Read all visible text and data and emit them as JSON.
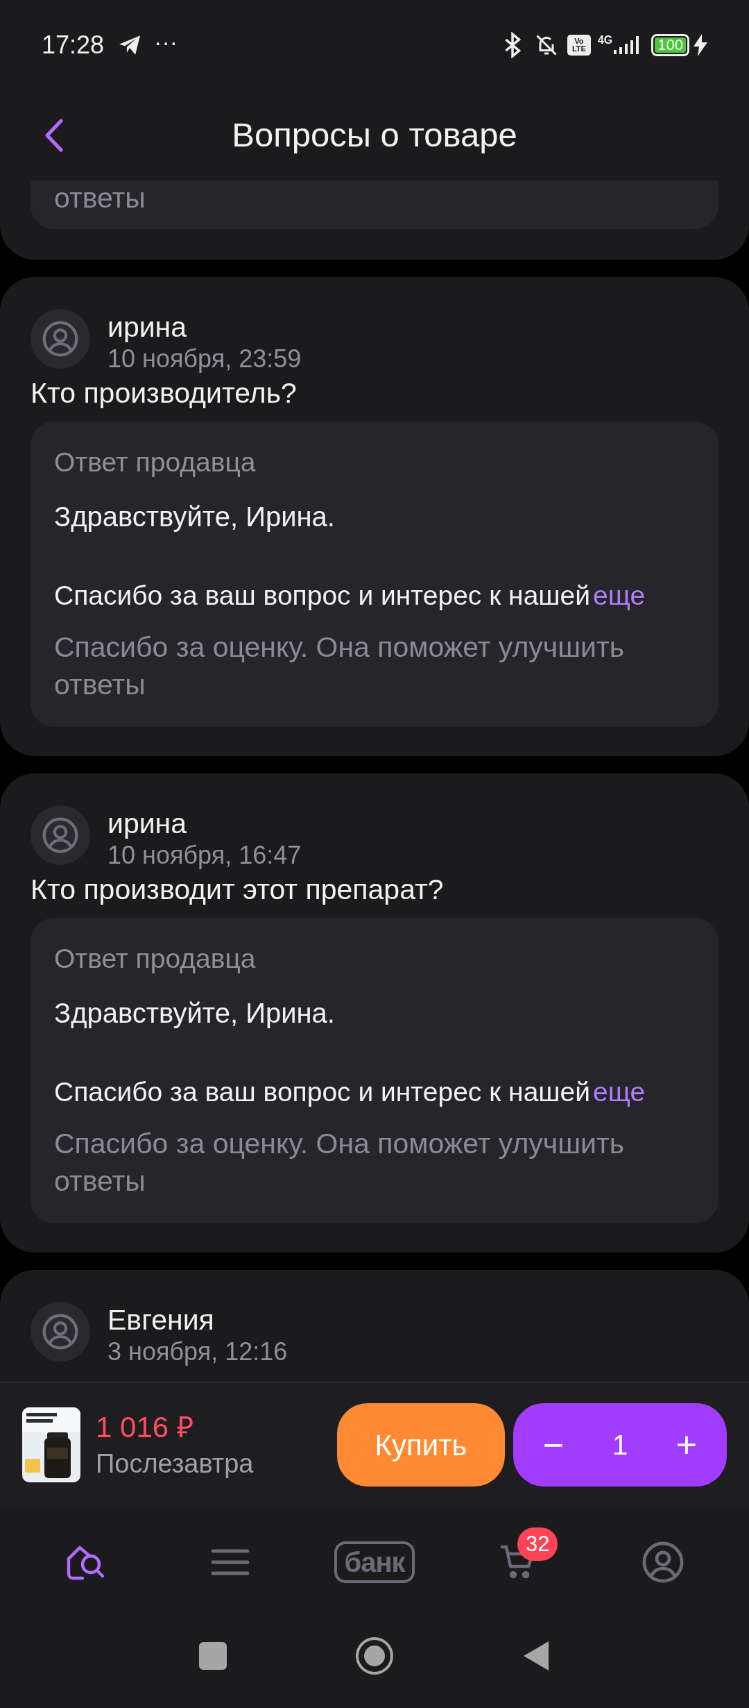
{
  "status_bar": {
    "time": "17:28",
    "more": "···",
    "volte": [
      "Vo",
      "LTE"
    ],
    "network": "4G",
    "battery": "100"
  },
  "header": {
    "title": "Вопросы о товаре"
  },
  "partial_answer": {
    "rating_note": "ответы"
  },
  "questions": [
    {
      "author": "ирина",
      "date": "10 ноября, 23:59",
      "question": "Кто производитель?",
      "answer": {
        "label": "Ответ продавца",
        "greeting": "Здравствуйте, Ирина.",
        "body": "Спасибо за ваш вопрос и интерес к нашей",
        "more": "еще",
        "rating_note": "Спасибо за оценку. Она поможет улучшить ответы"
      }
    },
    {
      "author": "ирина",
      "date": "10 ноября, 16:47",
      "question": "Кто производит этот препарат?",
      "answer": {
        "label": "Ответ продавца",
        "greeting": "Здравствуйте, Ирина.",
        "body": "Спасибо за ваш вопрос и интерес к нашей",
        "more": "еще",
        "rating_note": "Спасибо за оценку. Она поможет улучшить ответы"
      }
    },
    {
      "author": "Евгения",
      "date": "3 ноября, 12:16"
    }
  ],
  "buy_bar": {
    "price": "1 016 ₽",
    "delivery": "Послезавтра",
    "buy_button": "Купить",
    "minus": "−",
    "quantity": "1",
    "plus": "+"
  },
  "nav": [
    {
      "kind": "home",
      "selected": true
    },
    {
      "kind": "catalog",
      "selected": false
    },
    {
      "kind": "bank",
      "label": "банк",
      "selected": false
    },
    {
      "kind": "cart",
      "badge": "32",
      "selected": false
    },
    {
      "kind": "profile",
      "selected": false
    }
  ]
}
